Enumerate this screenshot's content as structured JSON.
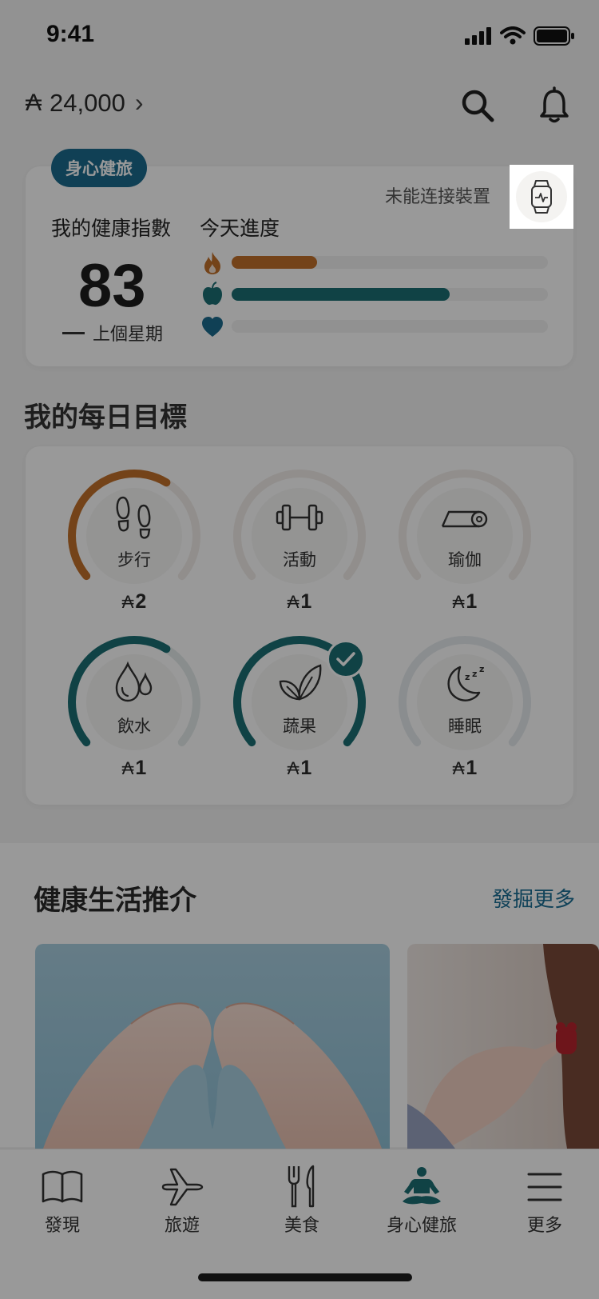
{
  "status_bar": {
    "time": "9:41"
  },
  "header": {
    "balance": "24,000",
    "coin_symbol": "₳",
    "chevron": "›"
  },
  "health_card": {
    "tag": "身心健旅",
    "device_status": "未能连接裝置",
    "index_label": "我的健康指數",
    "progress_label": "今天進度",
    "score": "83",
    "last_week": "上個星期",
    "progress": [
      {
        "icon": "flame-icon",
        "fraction": 0.27,
        "color": "#c2702a"
      },
      {
        "icon": "apple-icon",
        "fraction": 0.69,
        "color": "#1b6f74"
      },
      {
        "icon": "heart-icon",
        "fraction": 0.0,
        "color": "#1c6b8e"
      }
    ]
  },
  "goals": {
    "title": "我的每日目標",
    "items": [
      {
        "label": "步行",
        "reward": "2",
        "icon": "footprints-icon",
        "progress": 0.62,
        "color": "#c2702a",
        "track": "#f2ede9",
        "done": false
      },
      {
        "label": "活動",
        "reward": "1",
        "icon": "dumbbell-icon",
        "progress": 0.0,
        "color": "#c2702a",
        "track": "#f2ede9",
        "done": false
      },
      {
        "label": "瑜伽",
        "reward": "1",
        "icon": "yoga-mat-icon",
        "progress": 0.0,
        "color": "#c2702a",
        "track": "#f2ede9",
        "done": false
      },
      {
        "label": "飲水",
        "reward": "1",
        "icon": "water-drops-icon",
        "progress": 0.62,
        "color": "#1b6f74",
        "track": "#e5ecec",
        "done": false
      },
      {
        "label": "蔬果",
        "reward": "1",
        "icon": "leaves-icon",
        "progress": 1.0,
        "color": "#1b6f74",
        "track": "#e5ecec",
        "done": true
      },
      {
        "label": "睡眠",
        "reward": "1",
        "icon": "moon-sleep-icon",
        "progress": 0.0,
        "color": "#1c6b8e",
        "track": "#e6ebef",
        "done": false
      }
    ]
  },
  "lifestyle": {
    "title": "健康生活推介",
    "more": "發掘更多"
  },
  "nav": {
    "items": [
      {
        "label": "發現",
        "icon": "book-icon"
      },
      {
        "label": "旅遊",
        "icon": "airplane-icon"
      },
      {
        "label": "美食",
        "icon": "fork-knife-icon"
      },
      {
        "label": "身心健旅",
        "icon": "meditation-icon",
        "active": true
      },
      {
        "label": "更多",
        "icon": "menu-icon"
      }
    ]
  },
  "colors": {
    "orange": "#c2702a",
    "teal": "#1b6f74",
    "blue": "#1c6b8e",
    "overlay": "rgba(0,0,0,0.40)"
  }
}
